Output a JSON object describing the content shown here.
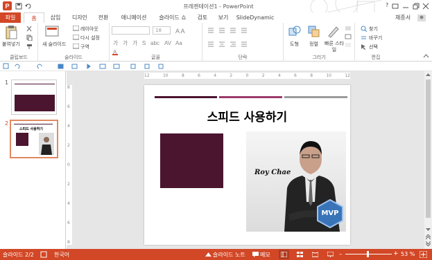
{
  "window": {
    "title": "프레젠테이션1 - PowerPoint",
    "user": "채종서",
    "help": "?"
  },
  "tabs": [
    "파일",
    "홈",
    "삽입",
    "디자인",
    "전환",
    "애니메이션",
    "슬라이드 쇼",
    "검토",
    "보기",
    "SlideDynamic"
  ],
  "active_tab": "홈",
  "ribbon": {
    "clipboard": {
      "paste": "붙여넣기",
      "label": "클립보드"
    },
    "slides": {
      "new": "새 슬라이드",
      "layout": "레이아웃",
      "reset": "다시 설정",
      "section": "구역",
      "label": "슬라이드"
    },
    "font": {
      "size": "18",
      "label": "글꼴"
    },
    "paragraph": {
      "label": "단락"
    },
    "drawing": {
      "shape": "도형",
      "arrange": "정렬",
      "quick_styles": "빠른 스타일",
      "label": "그리기"
    },
    "editing": {
      "find": "찾기",
      "replace": "바꾸기",
      "select": "선택",
      "label": "편집"
    }
  },
  "ruler": {
    "h_ticks": [
      "12",
      "10",
      "8",
      "6",
      "4",
      "2",
      "0",
      "2",
      "4",
      "6",
      "8",
      "10",
      "12"
    ],
    "v_ticks": [
      "8",
      "6",
      "4",
      "2",
      "0",
      "2",
      "4",
      "6",
      "8"
    ]
  },
  "thumbnails": [
    {
      "num": "1"
    },
    {
      "num": "2",
      "title": "스피드 사용하기"
    }
  ],
  "slide": {
    "title": "스피드 사용하기",
    "photo_caption": "Roy Chae",
    "badge": "MVP"
  },
  "status": {
    "slide_info": "슬라이드 2/2",
    "language": "한국어",
    "notes": "슬라이드 노트",
    "comments": "메모",
    "zoom": "53 %"
  },
  "colors": {
    "accent": "#d24726",
    "maroon": "#4b1530",
    "bar_pink": "#9c3a6a",
    "bar_gray": "#9a9a9a"
  }
}
